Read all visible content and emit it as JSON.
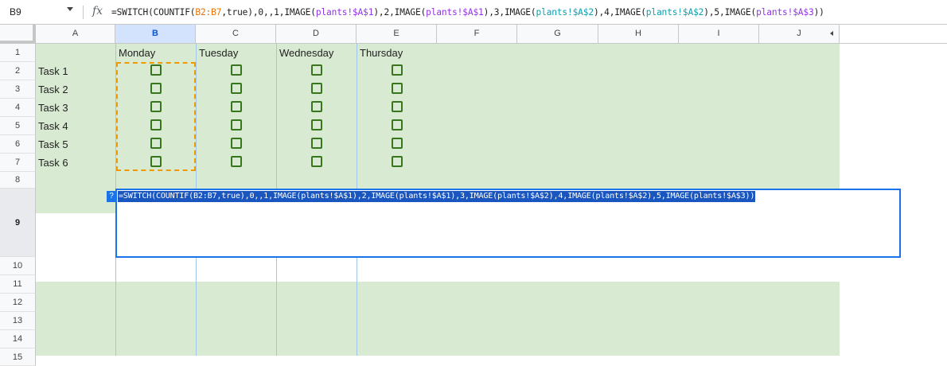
{
  "formula_bar": {
    "cell_ref": "B9",
    "fx_symbol": "fx",
    "formula_parts": [
      {
        "text": "=SWITCH(COUNTIF(",
        "kind": "plain"
      },
      {
        "text": "B2:B7",
        "kind": "range"
      },
      {
        "text": ",true),0,,1,IMAGE(",
        "kind": "plain"
      },
      {
        "text": "plants!$A$1",
        "kind": "ref"
      },
      {
        "text": "),2,IMAGE(",
        "kind": "plain"
      },
      {
        "text": "plants!$A$1",
        "kind": "ref"
      },
      {
        "text": "),3,IMAGE(",
        "kind": "plain"
      },
      {
        "text": "plants!$A$2",
        "kind": "ref2"
      },
      {
        "text": "),4,IMAGE(",
        "kind": "plain"
      },
      {
        "text": "plants!$A$2",
        "kind": "ref2"
      },
      {
        "text": "),5,IMAGE(",
        "kind": "plain"
      },
      {
        "text": "plants!$A$3",
        "kind": "ref"
      },
      {
        "text": "))",
        "kind": "plain"
      }
    ]
  },
  "columns": [
    "A",
    "B",
    "C",
    "D",
    "E",
    "F",
    "G",
    "H",
    "I",
    "J"
  ],
  "selected_column": "B",
  "rows": [
    "1",
    "2",
    "3",
    "4",
    "5",
    "6",
    "7",
    "8",
    "9",
    "10",
    "11",
    "12",
    "13",
    "14",
    "15"
  ],
  "selected_row": "9",
  "headers": {
    "monday": "Monday",
    "tuesday": "Tuesday",
    "wednesday": "Wednesday",
    "thursday": "Thursday"
  },
  "tasks": [
    "Task 1",
    "Task 2",
    "Task 3",
    "Task 4",
    "Task 5",
    "Task 6"
  ],
  "checkbox_states": [
    [
      false,
      false,
      false,
      false
    ],
    [
      false,
      false,
      false,
      false
    ],
    [
      false,
      false,
      false,
      false
    ],
    [
      false,
      false,
      false,
      false
    ],
    [
      false,
      false,
      false,
      false
    ],
    [
      false,
      false,
      false,
      false
    ]
  ],
  "editor": {
    "help_symbol": "?",
    "text": "=SWITCH(COUNTIF(B2:B7,true),0,,1,IMAGE(plants!$A$1),2,IMAGE(plants!$A$1),3,IMAGE(plants!$A$2),4,IMAGE(plants!$A$2),5,IMAGE(plants!$A$3))"
  },
  "colors": {
    "cell_fill": "#d9ead3",
    "checkbox": "#38761d",
    "selection": "#1a73e8",
    "range_highlight": "#f29900"
  }
}
